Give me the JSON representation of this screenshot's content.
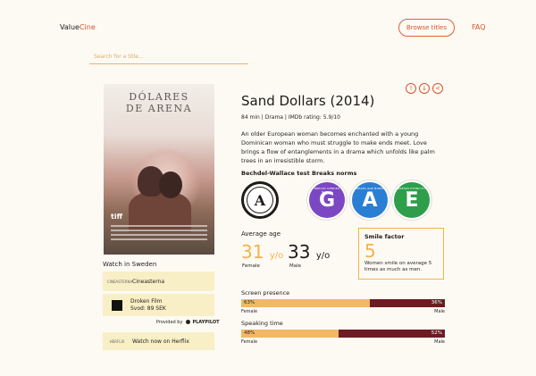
{
  "header": {
    "logo_prefix": "Value",
    "logo_suffix": "Cine",
    "browse_label": "Browse titles",
    "faq_label": "FAQ"
  },
  "search": {
    "placeholder": "Search for a title..."
  },
  "poster": {
    "title_line1": "DÓLARES",
    "title_line2": "DE ARENA",
    "festival": "tiff"
  },
  "watch": {
    "heading": "Watch in Sweden",
    "providers": [
      {
        "logo": "CINEASTERNA",
        "name": "Cineasterna",
        "detail": ""
      },
      {
        "logo": "",
        "name": "Droken Film",
        "detail": "Svod: 89 SEK"
      },
      {
        "logo": "HERFLIX",
        "name": "Watch now on Herflix",
        "detail": ""
      }
    ],
    "provided_by": "Provided by",
    "provided_brand": "PLAYPILOT"
  },
  "movie": {
    "title": "Sand Dollars (2014)",
    "meta": "84 min | Drama | IMDb rating: 5.9/10",
    "description": "An older European woman becomes enchanted with a young Dominican woman who must struggle to make ends meet. Love brings a flow of entanglements in a drama which unfolds like palm trees in an irresistible storm."
  },
  "bechdel": {
    "label": "Bechdel-Wallace test Breaks norms",
    "badges": [
      {
        "letter": "A",
        "color": "#1f1b18",
        "caption": ""
      },
      {
        "letter": "G",
        "color": "#7c47c2",
        "caption": "BREAKS GENDER NORMS"
      },
      {
        "letter": "A",
        "color": "#2a7fd4",
        "caption": "BREAKS AGE NORMS"
      },
      {
        "letter": "E",
        "color": "#2e9e4a",
        "caption": "BREAKS ETHNICITY NORMS"
      }
    ]
  },
  "age": {
    "label": "Average age",
    "female_value": "31",
    "male_value": "33",
    "unit": "y/o",
    "female_label": "Female",
    "male_label": "Male"
  },
  "smile": {
    "title": "Smile factor",
    "value": "5",
    "text": "Women smile on average 5 times as much as men."
  },
  "screen_presence": {
    "label": "Screen presence",
    "female_pct": "63%",
    "male_pct": "36%",
    "female_fraction": 0.63,
    "female_label": "Female",
    "male_label": "Male"
  },
  "speaking_time": {
    "label": "Speaking time",
    "female_pct": "48%",
    "male_pct": "52%",
    "female_fraction": 0.48,
    "female_label": "Female",
    "male_label": "Male"
  },
  "colors": {
    "accent": "#d9532c",
    "female": "#f3b766",
    "male": "#6e1b22",
    "panel": "#f9efc6"
  }
}
